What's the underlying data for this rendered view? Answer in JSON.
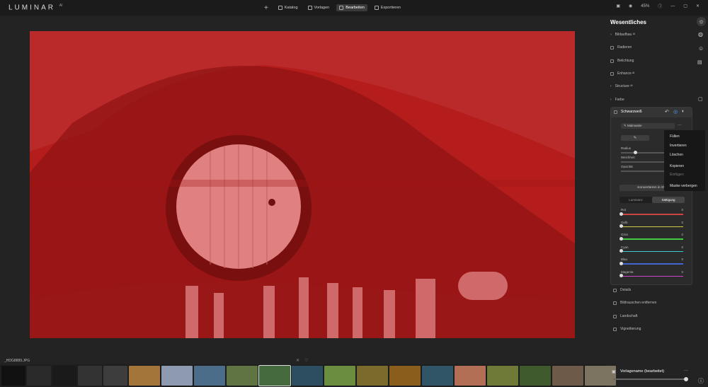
{
  "app": {
    "name": "LUMINAR",
    "version": "AI"
  },
  "nav": {
    "add": "+",
    "items": [
      {
        "label": "Katalog",
        "active": false
      },
      {
        "label": "Vorlagen",
        "active": false
      },
      {
        "label": "Bearbeiten",
        "active": true
      },
      {
        "label": "Exportieren",
        "active": false
      }
    ]
  },
  "toolbar": {
    "zoom": "45%"
  },
  "panel": {
    "title": "Wesentliches",
    "tools_top": [
      "Bildaufbau ᴬᴵ",
      "Radieren",
      "Belichtung",
      "Enhance ᴬᴵ",
      "Structure ᴬᴵ",
      "Farbe"
    ],
    "active_tool": "Schwarzweiß",
    "mask_select": "Malmaske",
    "sliders_top": [
      "Radius",
      "Weichheit",
      "Opazität"
    ],
    "convert_button": "Konvertieren in SW",
    "tabs": [
      "Luminanz",
      "Sättigung"
    ],
    "color_sliders": [
      {
        "label": "Rot",
        "value": "0",
        "color": "#c44"
      },
      {
        "label": "Gelb",
        "value": "0",
        "color": "#cc4"
      },
      {
        "label": "Grün",
        "value": "0",
        "color": "#4c4"
      },
      {
        "label": "Cyan",
        "value": "0",
        "color": "#4cc"
      },
      {
        "label": "Blau",
        "value": "0",
        "color": "#46c"
      },
      {
        "label": "Magenta",
        "value": "0",
        "color": "#c4c"
      }
    ],
    "tools_bottom": [
      "Details",
      "Bildrauschen entfernen",
      "Landschaft",
      "Vignettierung"
    ]
  },
  "context_menu": [
    "Füllen",
    "Invertieren",
    "Löschen",
    "Kopieren",
    "Einfügen",
    "Maske verbergen"
  ],
  "filmstrip": {
    "filename": "_HDG8889.JPG"
  },
  "preset": {
    "name": "Vorlagename (bearbeitet)",
    "more": "···"
  },
  "colors": {
    "mask": "#b31b1b",
    "bg": "#232323",
    "accent": "#4aa3ff"
  }
}
